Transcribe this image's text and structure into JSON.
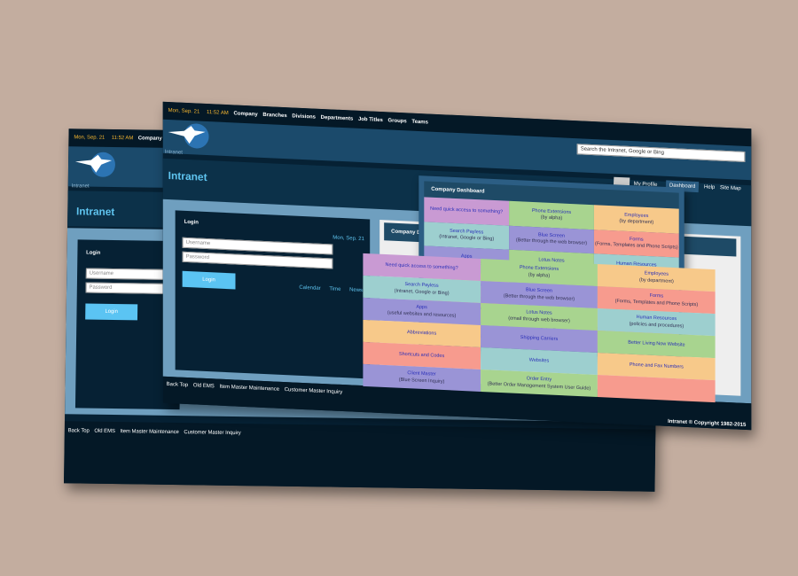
{
  "back_screenshot": {
    "date": "Mon, Sep. 21",
    "time": "11:52 AM",
    "nav": [
      "Company",
      "B"
    ],
    "subtitle": "Intranet",
    "title": "Intranet",
    "login": {
      "label": "Login",
      "username_placeholder": "Username",
      "password_placeholder": "Password",
      "button": "Login"
    },
    "footer_links": [
      "Back Top",
      "Old EMS",
      "Item Master Maintenance",
      "Customer Master Inquiry"
    ]
  },
  "front_screenshot": {
    "date": "Mon, Sep. 21",
    "time": "11:52 AM",
    "nav": [
      "Company",
      "Branches",
      "Divisions",
      "Departments",
      "Job Titles",
      "Groups",
      "Teams"
    ],
    "search_placeholder": "Search the Intranet, Google or Bing",
    "subtitle": "Intranet",
    "title": "Intranet",
    "profile": "My Profile",
    "tabs": [
      "Dashboard",
      "Help",
      "Site Map"
    ],
    "login": {
      "label": "Login",
      "date": "Mon, Sep. 21",
      "username_placeholder": "Username",
      "password_placeholder": "Password",
      "button": "Login",
      "links": [
        "Calendar",
        "Time",
        "News"
      ]
    },
    "dashboard_header": "Company Dashboard",
    "dashboard_cells": [
      {
        "title": "Need quick access to something?",
        "sub": "",
        "color": "#c99ad3"
      },
      {
        "title": "Phone Extensions",
        "sub": "(by alpha)",
        "color": "#a8d48f"
      },
      {
        "title": "Employees",
        "sub": "(by department)",
        "color": "#f7c98a"
      },
      {
        "title": "Search Payless",
        "sub": "(Intranet, Google or Bing)",
        "color": "#9dcfcf"
      },
      {
        "title": "Blue Screen",
        "sub": "(Better through the web browser)",
        "color": "#9a94d6"
      },
      {
        "title": "Forms",
        "sub": "(Forms, Templates and Phone Scripts)",
        "color": "#f79b8e"
      },
      {
        "title": "Apps",
        "sub": "(useful websites and resources)",
        "color": "#9a94d6"
      },
      {
        "title": "Lotus Notes",
        "sub": "(email through web browser)",
        "color": "#a8d48f"
      },
      {
        "title": "Human Resources",
        "sub": "(policies and procedures)",
        "color": "#9dcfcf"
      },
      {
        "title": "Abbreviations",
        "sub": "",
        "color": "#f7c98a"
      },
      {
        "title": "Shipping Carriers",
        "sub": "",
        "color": "#9a94d6"
      },
      {
        "title": "Better Living Now Website",
        "sub": "",
        "color": "#a8d48f"
      },
      {
        "title": "Shortcuts and Codes",
        "sub": "",
        "color": "#f79b8e"
      },
      {
        "title": "Websites",
        "sub": "",
        "color": "#9dcfcf"
      },
      {
        "title": "Phone and Fax Numbers",
        "sub": "",
        "color": "#f7c98a"
      },
      {
        "title": "Client Master",
        "sub": "(Blue Screen Inquiry)",
        "color": "#9a94d6"
      },
      {
        "title": "Order Entry",
        "sub": "(Better Order Management System User Guide)",
        "color": "#a8d48f"
      },
      {
        "title": "",
        "sub": "",
        "color": "#f79b8e"
      }
    ],
    "footer_links": [
      "Back Top",
      "Old EMS",
      "Item Master Maintenance",
      "Customer Master Inquiry"
    ],
    "copyright": "Intranet © Copyright 1982-2015"
  },
  "colors": {
    "background": "#c3ad9f",
    "page": "#062134",
    "accent": "#5bc4f3",
    "date": "#f5b630"
  }
}
